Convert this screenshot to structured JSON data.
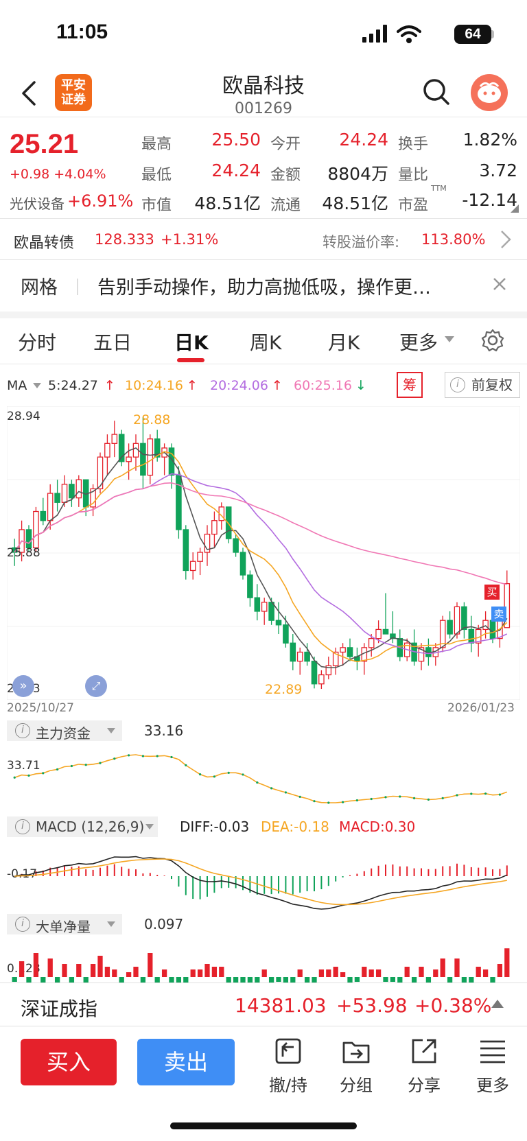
{
  "status_bar": {
    "time": "11:05",
    "battery": "64"
  },
  "header": {
    "stock_name": "欧晶科技",
    "stock_code": "001269",
    "broker_logo": "平安证券"
  },
  "quote": {
    "price": "25.21",
    "change": "+0.98 +4.04%",
    "sector_name": "光伏设备",
    "sector_change": "+6.91%",
    "fields": [
      {
        "label": "最高",
        "value": "25.50",
        "color": "red"
      },
      {
        "label": "今开",
        "value": "24.24",
        "color": "red"
      },
      {
        "label": "换手",
        "value": "1.82%",
        "color": "black"
      },
      {
        "label": "最低",
        "value": "24.24",
        "color": "red"
      },
      {
        "label": "金额",
        "value": "8804万",
        "color": "black"
      },
      {
        "label": "量比",
        "value": "3.72",
        "color": "black"
      },
      {
        "label": "市值",
        "value": "48.51亿",
        "color": "black"
      },
      {
        "label": "流通",
        "value": "48.51亿",
        "color": "black"
      },
      {
        "label": "市盈",
        "value": "-12.14",
        "color": "black"
      }
    ],
    "pe_superscript": "TTM"
  },
  "bond": {
    "name": "欧晶转债",
    "price": "128.333",
    "change": "+1.31%",
    "premium_label": "转股溢价率:",
    "premium_value": "113.80%"
  },
  "notice": {
    "tag": "网格",
    "text": "告别手动操作，助力高抛低吸，操作更…"
  },
  "tabs": [
    "分时",
    "五日",
    "日K",
    "周K",
    "月K",
    "更多"
  ],
  "active_tab": "日K",
  "ma_legend": {
    "label": "MA",
    "ma5": "5:24.27",
    "ma10": "10:24.16",
    "ma20": "20:24.06",
    "ma60": "60:25.16",
    "chip": "筹",
    "adjust": "前复权"
  },
  "chart_labels": {
    "y_top": "28.94",
    "y_mid": "25.88",
    "y_low": "22.83",
    "high_mark": "28.88",
    "low_mark": "22.89",
    "date_start": "2025/10/27",
    "date_end": "2026/01/23",
    "buy_tag": "买",
    "sell_tag": "卖"
  },
  "indicators": {
    "capital": {
      "title": "主力资金",
      "value": "33.16",
      "axis": "33.71"
    },
    "macd": {
      "title": "MACD (12,26,9)",
      "diff": "DIFF:-0.03",
      "dea": "DEA:-0.18",
      "macd": "MACD:0.30",
      "axis": "-0.17"
    },
    "bigorder": {
      "title": "大单净量",
      "value": "0.097",
      "axis": "0.128"
    }
  },
  "index": {
    "name": "深证成指",
    "value": "14381.03",
    "change": "+53.98",
    "percent": "+0.38%"
  },
  "bottom_bar": {
    "buy": "买入",
    "sell": "卖出",
    "items": [
      "撤/持",
      "分组",
      "分享",
      "更多"
    ]
  },
  "chart_data": {
    "type": "candlestick",
    "ohlc": [
      [
        26.0,
        26.2,
        25.6,
        25.9
      ],
      [
        25.9,
        26.6,
        25.7,
        26.4
      ],
      [
        26.4,
        26.5,
        25.9,
        26.0
      ],
      [
        26.0,
        26.9,
        25.9,
        26.8
      ],
      [
        26.8,
        27.1,
        26.5,
        26.6
      ],
      [
        26.6,
        27.4,
        26.4,
        27.2
      ],
      [
        27.2,
        27.5,
        26.8,
        27.0
      ],
      [
        27.0,
        27.6,
        26.9,
        27.4
      ],
      [
        27.4,
        27.5,
        26.9,
        27.1
      ],
      [
        27.1,
        27.6,
        26.9,
        27.5
      ],
      [
        27.5,
        27.4,
        26.7,
        26.9
      ],
      [
        26.9,
        27.4,
        26.7,
        27.3
      ],
      [
        27.3,
        28.1,
        27.2,
        28.0
      ],
      [
        28.0,
        28.5,
        27.6,
        28.3
      ],
      [
        28.3,
        28.8,
        28.0,
        28.5
      ],
      [
        28.5,
        28.6,
        27.8,
        27.9
      ],
      [
        27.9,
        28.3,
        27.5,
        28.0
      ],
      [
        28.0,
        28.5,
        27.7,
        28.3
      ],
      [
        28.3,
        28.88,
        27.3,
        27.6
      ],
      [
        27.6,
        28.5,
        27.4,
        28.4
      ],
      [
        28.4,
        28.6,
        27.9,
        28.0
      ],
      [
        28.0,
        28.3,
        27.6,
        28.2
      ],
      [
        28.2,
        28.3,
        27.3,
        27.6
      ],
      [
        27.6,
        27.8,
        26.2,
        26.4
      ],
      [
        26.4,
        26.5,
        25.3,
        25.5
      ],
      [
        25.5,
        25.9,
        25.3,
        25.7
      ],
      [
        25.7,
        26.0,
        25.4,
        25.9
      ],
      [
        25.9,
        26.5,
        25.6,
        26.3
      ],
      [
        26.3,
        26.8,
        26.0,
        26.6
      ],
      [
        26.6,
        27.0,
        26.4,
        26.9
      ],
      [
        26.9,
        26.9,
        26.1,
        26.2
      ],
      [
        26.2,
        26.3,
        25.8,
        25.9
      ],
      [
        25.9,
        26.0,
        25.3,
        25.4
      ],
      [
        25.4,
        25.5,
        24.7,
        24.9
      ],
      [
        24.9,
        25.2,
        24.4,
        24.6
      ],
      [
        24.6,
        24.9,
        24.3,
        24.8
      ],
      [
        24.8,
        24.9,
        24.3,
        24.4
      ],
      [
        24.4,
        24.8,
        24.1,
        24.3
      ],
      [
        24.3,
        24.5,
        23.8,
        23.9
      ],
      [
        23.9,
        24.1,
        23.3,
        23.5
      ],
      [
        23.5,
        23.8,
        23.2,
        23.7
      ],
      [
        23.7,
        23.9,
        23.4,
        23.5
      ],
      [
        23.5,
        23.6,
        22.9,
        23.0
      ],
      [
        23.0,
        23.3,
        22.89,
        23.2
      ],
      [
        23.2,
        23.6,
        23.1,
        23.4
      ],
      [
        23.4,
        23.8,
        23.2,
        23.7
      ],
      [
        23.7,
        23.9,
        23.4,
        23.8
      ],
      [
        23.8,
        24.0,
        23.5,
        23.6
      ],
      [
        23.6,
        23.8,
        23.3,
        23.5
      ],
      [
        23.5,
        23.9,
        23.2,
        23.8
      ],
      [
        23.8,
        24.1,
        23.6,
        24.0
      ],
      [
        24.0,
        24.4,
        23.9,
        24.2
      ],
      [
        24.2,
        25.0,
        24.1,
        24.1
      ],
      [
        24.1,
        24.6,
        23.9,
        24.0
      ],
      [
        24.0,
        24.2,
        23.5,
        23.6
      ],
      [
        23.6,
        24.0,
        23.5,
        23.9
      ],
      [
        23.9,
        24.2,
        23.4,
        23.5
      ],
      [
        23.5,
        23.9,
        23.3,
        23.8
      ],
      [
        23.8,
        24.0,
        23.4,
        23.6
      ],
      [
        23.6,
        23.9,
        23.4,
        23.8
      ],
      [
        23.8,
        24.5,
        23.7,
        24.4
      ],
      [
        24.4,
        24.6,
        24.0,
        24.1
      ],
      [
        24.1,
        24.8,
        24.0,
        24.7
      ],
      [
        24.7,
        24.8,
        24.0,
        24.2
      ],
      [
        24.2,
        24.5,
        23.7,
        23.9
      ],
      [
        23.9,
        24.3,
        23.6,
        24.2
      ],
      [
        24.2,
        24.6,
        24.0,
        24.4
      ],
      [
        24.4,
        24.7,
        23.9,
        24.0
      ],
      [
        24.0,
        24.5,
        23.8,
        24.4
      ],
      [
        24.24,
        25.5,
        24.24,
        25.21
      ]
    ],
    "ylim": [
      22.83,
      28.94
    ],
    "x_range": [
      "2025/10/27",
      "2026/01/23"
    ]
  }
}
